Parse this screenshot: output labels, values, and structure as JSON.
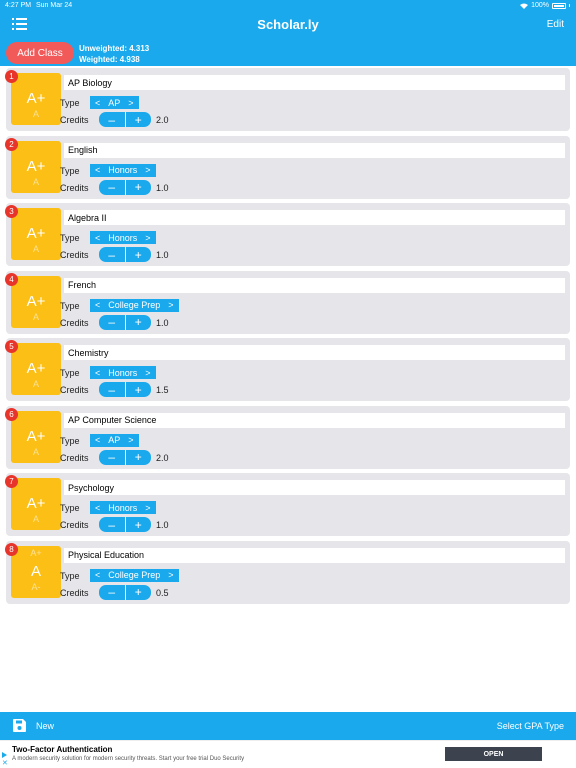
{
  "status": {
    "time": "4:27 PM",
    "date": "Sun Mar 24",
    "battery": "100%"
  },
  "header": {
    "title": "Scholar.ly",
    "edit_label": "Edit"
  },
  "toolbar": {
    "add_class_label": "Add Class",
    "unweighted": "Unweighted: 4.313",
    "weighted": "Weighted: 4.938"
  },
  "labels": {
    "type": "Type",
    "credits": "Credits"
  },
  "classes": [
    {
      "num": "1",
      "name": "AP Biology",
      "type": "AP",
      "credits": "2.0",
      "grade": "A+",
      "grade_next": "A"
    },
    {
      "num": "2",
      "name": "English",
      "type": "Honors",
      "credits": "1.0",
      "grade": "A+",
      "grade_next": "A"
    },
    {
      "num": "3",
      "name": "Algebra II",
      "type": "Honors",
      "credits": "1.0",
      "grade": "A+",
      "grade_next": "A"
    },
    {
      "num": "4",
      "name": "French",
      "type": "College Prep",
      "credits": "1.0",
      "grade": "A+",
      "grade_next": "A"
    },
    {
      "num": "5",
      "name": "Chemistry",
      "type": "Honors",
      "credits": "1.5",
      "grade": "A+",
      "grade_next": "A"
    },
    {
      "num": "6",
      "name": "AP Computer Science",
      "type": "AP",
      "credits": "2.0",
      "grade": "A+",
      "grade_next": "A"
    },
    {
      "num": "7",
      "name": "Psychology",
      "type": "Honors",
      "credits": "1.0",
      "grade": "A+",
      "grade_next": "A"
    },
    {
      "num": "8",
      "name": "Physical Education",
      "type": "College Prep",
      "credits": "0.5",
      "grade": "A",
      "grade_prev": "A+",
      "grade_next": "A-"
    }
  ],
  "bottom": {
    "new_label": "New",
    "gpa_type_label": "Select GPA Type"
  },
  "ad": {
    "title": "Two-Factor Authentication",
    "description": "A modern security solution for modern security threats. Start your free trial Duo Security",
    "cta": "OPEN"
  },
  "colors": {
    "accent": "#1aa9ec",
    "add_button": "#f25a5a",
    "grade_tile": "#fbbf16",
    "badge": "#e8352b"
  }
}
